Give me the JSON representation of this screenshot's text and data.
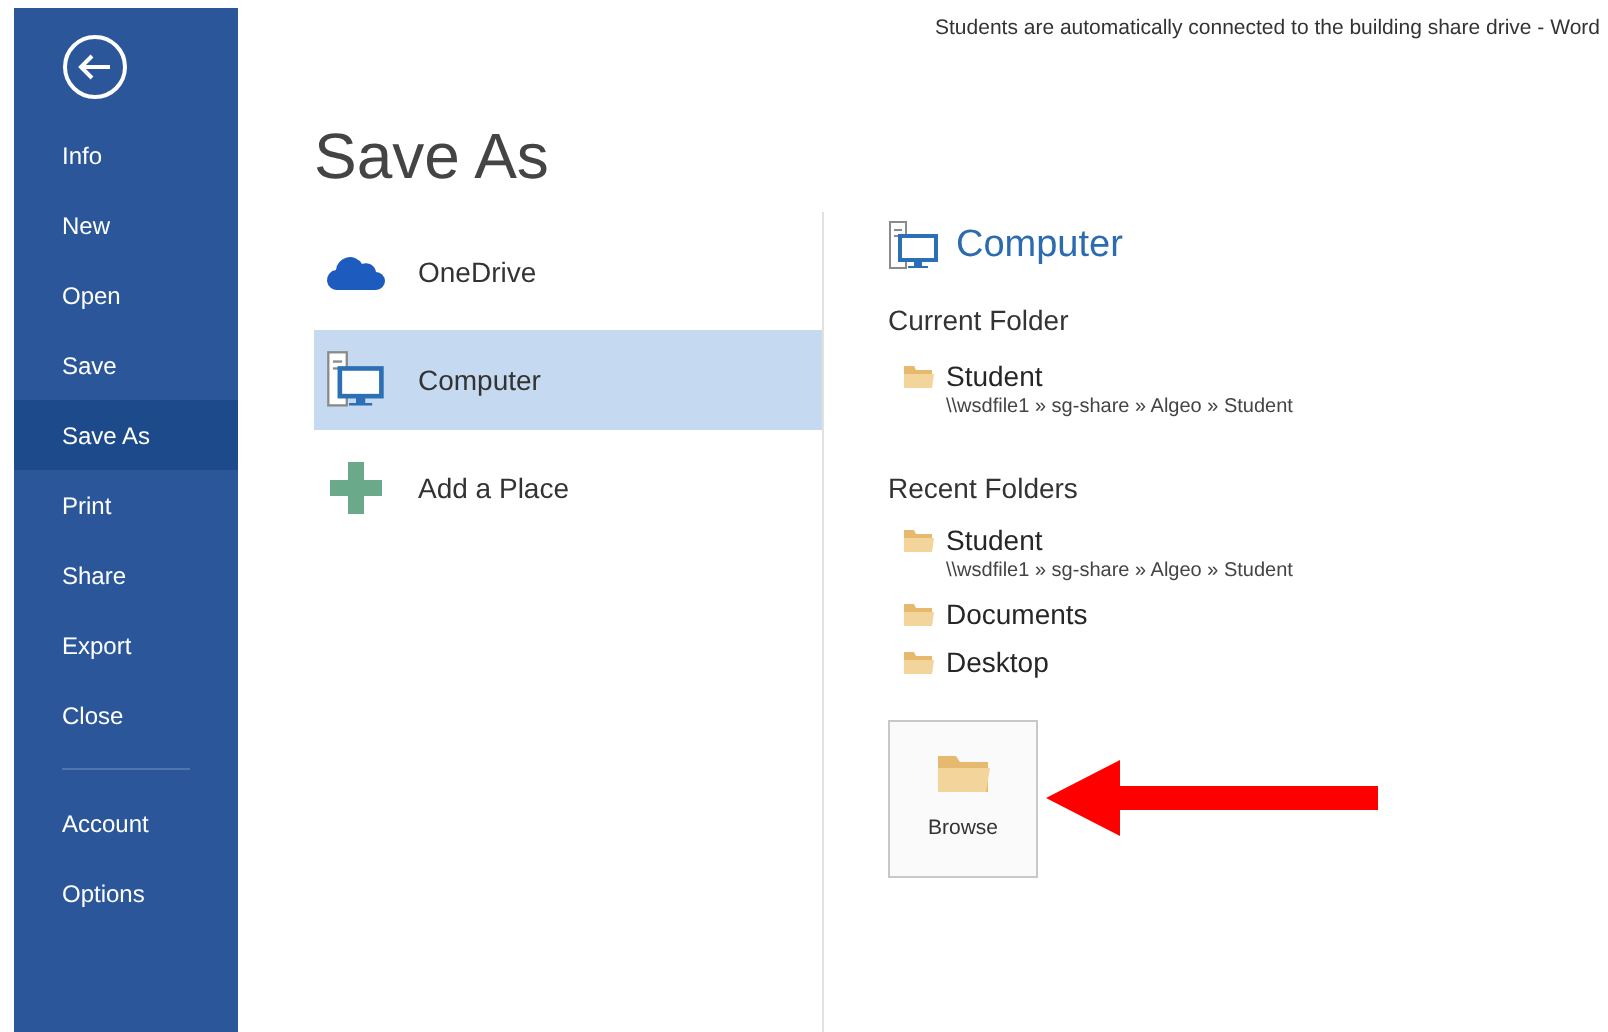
{
  "window": {
    "title": "Students are automatically connected to the building share drive - Word"
  },
  "sidebar": {
    "items": [
      {
        "label": "Info",
        "selected": false
      },
      {
        "label": "New",
        "selected": false
      },
      {
        "label": "Open",
        "selected": false
      },
      {
        "label": "Save",
        "selected": false
      },
      {
        "label": "Save As",
        "selected": true
      },
      {
        "label": "Print",
        "selected": false
      },
      {
        "label": "Share",
        "selected": false
      },
      {
        "label": "Export",
        "selected": false
      },
      {
        "label": "Close",
        "selected": false
      }
    ],
    "bottom_items": [
      {
        "label": "Account",
        "selected": false
      },
      {
        "label": "Options",
        "selected": false
      }
    ]
  },
  "page_title": "Save As",
  "places": [
    {
      "kind": "cloud",
      "label": "OneDrive",
      "selected": false
    },
    {
      "kind": "computer",
      "label": "Computer",
      "selected": true
    },
    {
      "kind": "add",
      "label": "Add a Place",
      "selected": false
    }
  ],
  "panel": {
    "heading": "Computer",
    "current_folder": {
      "label": "Current Folder",
      "folders": [
        {
          "name": "Student",
          "path": "\\\\wsdfile1 » sg-share » Algeo » Student"
        }
      ]
    },
    "recent_folders": {
      "label": "Recent Folders",
      "folders": [
        {
          "name": "Student",
          "path": "\\\\wsdfile1 » sg-share » Algeo » Student"
        },
        {
          "name": "Documents"
        },
        {
          "name": "Desktop"
        }
      ]
    },
    "browse_button": "Browse"
  }
}
